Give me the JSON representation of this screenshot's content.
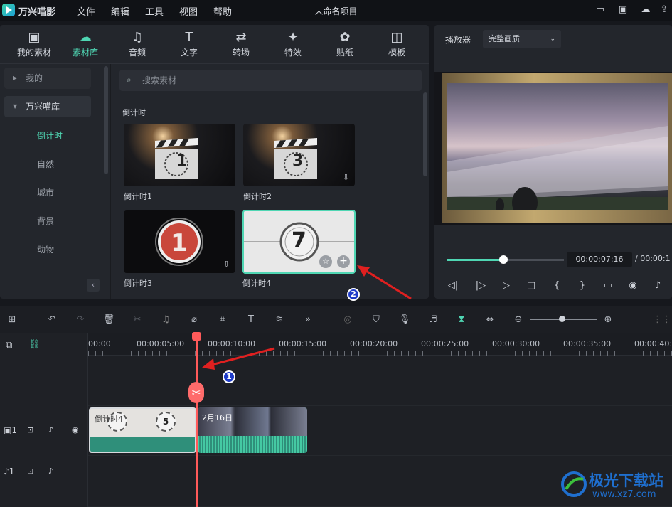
{
  "app": {
    "title": "万兴喵影",
    "project_name": "未命名项目"
  },
  "menu": [
    "文件",
    "编辑",
    "工具",
    "视图",
    "帮助"
  ],
  "categories": [
    {
      "label": "我的素材",
      "icon": "image-icon"
    },
    {
      "label": "素材库",
      "icon": "cloud-icon"
    },
    {
      "label": "音频",
      "icon": "music-icon"
    },
    {
      "label": "文字",
      "icon": "text-icon"
    },
    {
      "label": "转场",
      "icon": "transition-icon"
    },
    {
      "label": "特效",
      "icon": "sparkle-icon"
    },
    {
      "label": "贴纸",
      "icon": "sticker-icon"
    },
    {
      "label": "模板",
      "icon": "template-icon"
    }
  ],
  "sidebar": {
    "groups": [
      "我的",
      "万兴喵库"
    ],
    "items": [
      "倒计时",
      "自然",
      "城市",
      "背景",
      "动物"
    ]
  },
  "search": {
    "placeholder": "搜索素材"
  },
  "section_title": "倒计时",
  "assets": [
    {
      "label": "倒计时1",
      "digit": "1"
    },
    {
      "label": "倒计时2",
      "digit": "3"
    },
    {
      "label": "倒计时3",
      "digit": "1"
    },
    {
      "label": "倒计时4",
      "digit": "7"
    }
  ],
  "player": {
    "label": "播放器",
    "quality": "完整画质",
    "current_time": "00:00:07:16",
    "total_time": "/  00:00:1",
    "progress": 0.49
  },
  "ruler": [
    "00:00",
    "00:00:05:00",
    "00:00:10:00",
    "00:00:15:00",
    "00:00:20:00",
    "00:00:25:00",
    "00:00:30:00",
    "00:00:35:00",
    "00:00:40:"
  ],
  "clips": [
    {
      "name": "倒计时4"
    },
    {
      "name": "2月16日"
    }
  ],
  "annotations": [
    "1",
    "2"
  ],
  "watermark": {
    "line1": "极光下载站",
    "line2": "www.xz7.com"
  },
  "accent_color": "#4fd6b3",
  "playhead_color": "#ff5a5a"
}
